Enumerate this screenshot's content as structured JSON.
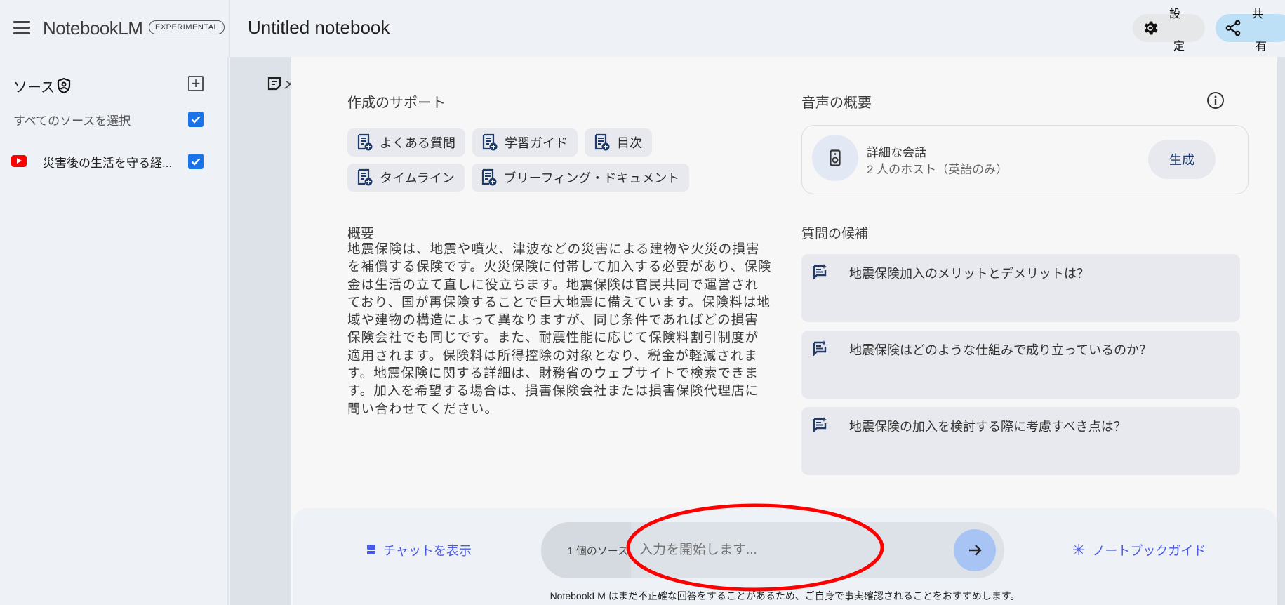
{
  "header": {
    "brand": "NotebookLM",
    "badge": "EXPERIMENTAL",
    "title": "Untitled notebook",
    "settings_label_top": "設",
    "settings_label_bottom": "定",
    "share_label_top": "共",
    "share_label_bottom": "有"
  },
  "sidebar": {
    "title": "ソース",
    "select_all": "すべてのソースを選択",
    "select_all_checked": true,
    "sources": [
      {
        "label": "災害後の生活を守る経...",
        "type": "youtube",
        "checked": true
      }
    ]
  },
  "notes_tab_partial": "メ",
  "guide": {
    "support_title": "作成のサポート",
    "chips": [
      "よくある質問",
      "学習ガイド",
      "目次",
      "タイムライン",
      "ブリーフィング・ドキュメント"
    ],
    "summary_title": "概要",
    "summary": "地震保険は、地震や噴火、津波などの災害による建物や火災の損害を補償する保険です。火災保険に付帯して加入する必要があり、保険金は生活の立て直しに役立ちます。地震保険は官民共同で運営されており、国が再保険することで巨大地震に備えています。保険料は地域や建物の構造によって異なりますが、同じ条件であればどの損害保険会社でも同じです。また、耐震性能に応じて保険料割引制度が適用されます。保険料は所得控除の対象となり、税金が軽減されます。地震保険に関する詳細は、財務省のウェブサイトで検索できます。加入を希望する場合は、損害保険会社または損害保険代理店に問い合わせてください。",
    "audio_title": "音声の概要",
    "audio_card": {
      "title": "詳細な会話",
      "subtitle": "2 人のホスト（英語のみ）",
      "button": "生成"
    },
    "questions_title": "質問の候補",
    "questions": [
      "地震保険加入のメリットとデメリットは？",
      "地震保険はどのような仕組みで成り立っているのか？",
      "地震保険の加入を検討する際に考慮すべき点は？"
    ]
  },
  "chatbar": {
    "show_chat": "チャットを表示",
    "source_count": "1 個のソース",
    "input_placeholder": "入力を開始します...",
    "input_value": "",
    "notebook_guide": "ノートブックガイド",
    "disclaimer": "NotebookLM はまだ不正確な回答をすることがあるため、ご自身で事実確認されることをおすすめします。"
  },
  "colors": {
    "accent": "#1a73e8",
    "link": "#4a5ae8",
    "annotation": "#ff0000",
    "send": "#a8c4f4",
    "share_bg": "#bee0f7"
  }
}
